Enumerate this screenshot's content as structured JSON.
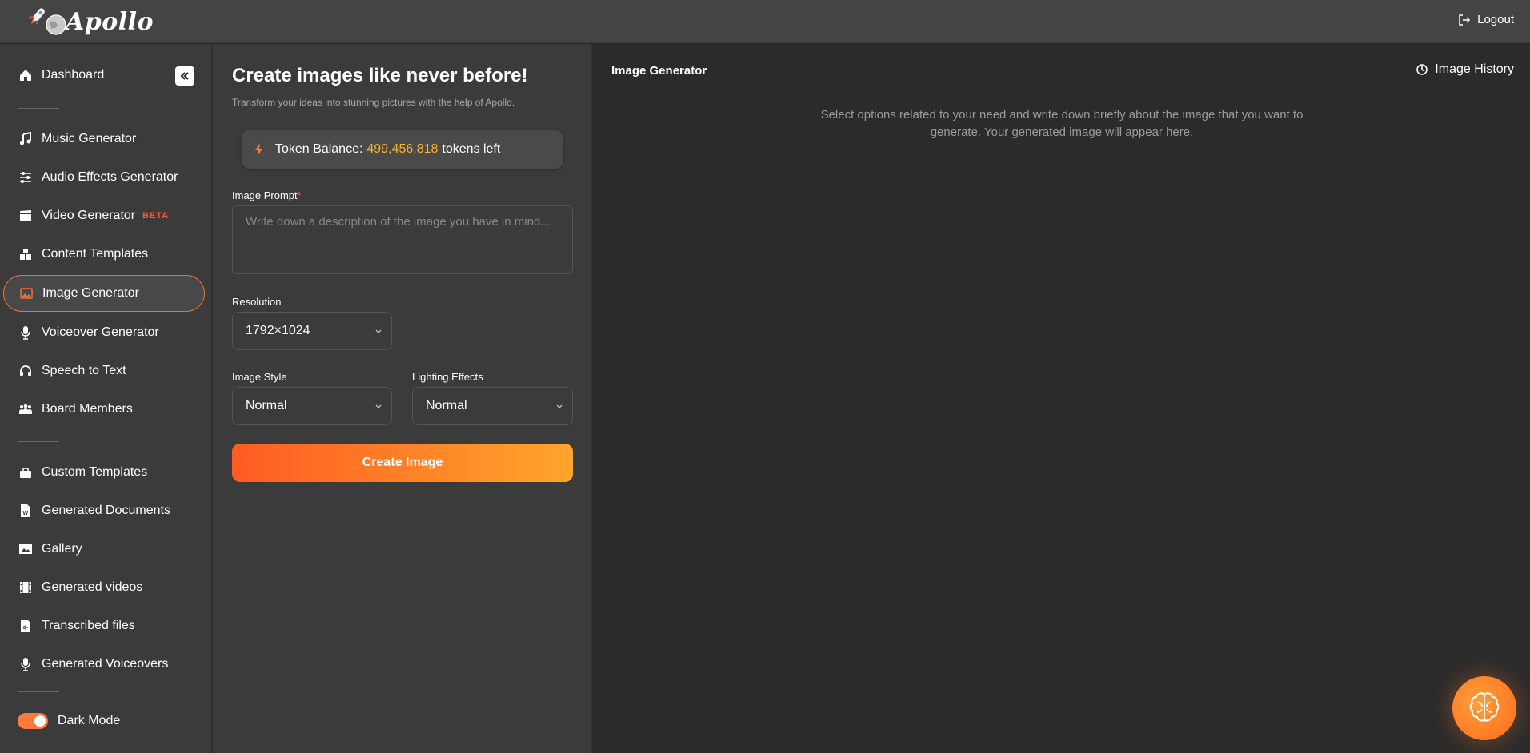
{
  "app": {
    "name": "Apollo",
    "logout": "Logout"
  },
  "sidebar": {
    "items": [
      {
        "label": "Dashboard",
        "icon": "home-icon"
      },
      {
        "label": "Music Generator",
        "icon": "music-note-icon"
      },
      {
        "label": "Audio Effects Generator",
        "icon": "sliders-icon"
      },
      {
        "label": "Video Generator",
        "icon": "clapperboard-icon",
        "badge": "BETA"
      },
      {
        "label": "Content Templates",
        "icon": "boxes-icon"
      },
      {
        "label": "Image Generator",
        "icon": "image-icon",
        "active": true
      },
      {
        "label": "Voiceover Generator",
        "icon": "microphone-icon"
      },
      {
        "label": "Speech to Text",
        "icon": "headset-icon"
      },
      {
        "label": "Board Members",
        "icon": "people-icon"
      },
      {
        "label": "Custom Templates",
        "icon": "toolbox-icon"
      },
      {
        "label": "Generated Documents",
        "icon": "word-doc-icon"
      },
      {
        "label": "Gallery",
        "icon": "photo-icon"
      },
      {
        "label": "Generated videos",
        "icon": "film-icon"
      },
      {
        "label": "Transcribed files",
        "icon": "audio-file-icon"
      },
      {
        "label": "Generated Voiceovers",
        "icon": "microphone-icon"
      }
    ],
    "dark_mode_label": "Dark Mode",
    "dark_mode_on": true
  },
  "form": {
    "title": "Create images like never before!",
    "subtitle": "Transform your ideas into stunning pictures with the help of Apollo.",
    "token": {
      "prefix": "Token Balance:",
      "amount": "499,456,818",
      "suffix": "tokens left"
    },
    "prompt_label": "Image Prompt",
    "prompt_required": "*",
    "prompt_placeholder": "Write down a description of the image you have in mind...",
    "resolution_label": "Resolution",
    "resolution_value": "1792×1024",
    "style_label": "Image Style",
    "style_value": "Normal",
    "lighting_label": "Lighting Effects",
    "lighting_value": "Normal",
    "create_button": "Create Image"
  },
  "output": {
    "title": "Image Generator",
    "history_label": "Image History",
    "info": "Select options related to your need and write down briefly about the image that you want to generate. Your generated image will appear here."
  },
  "colors": {
    "accent": "#ff7a3b",
    "token_amount": "#f7b52c",
    "beta": "#ff5a2c",
    "button_start": "#ff5b22",
    "button_end": "#ffa52c"
  }
}
